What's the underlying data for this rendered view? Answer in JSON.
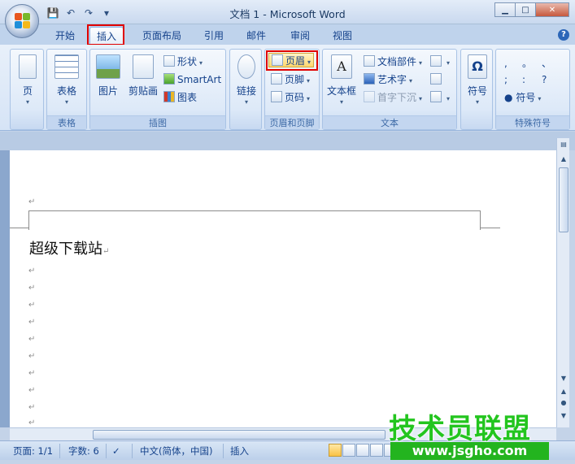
{
  "window": {
    "title": "文档 1 - Microsoft Word",
    "controls": {
      "minimize": "▁",
      "maximize": "□",
      "close": "✕"
    }
  },
  "qat": {
    "save_icon": "save-icon",
    "undo_icon": "undo-icon",
    "redo_icon": "redo-icon",
    "customize_icon": "customize-qat-icon"
  },
  "tabs": [
    {
      "label": "开始"
    },
    {
      "label": "插入"
    },
    {
      "label": "页面布局"
    },
    {
      "label": "引用"
    },
    {
      "label": "邮件"
    },
    {
      "label": "审阅"
    },
    {
      "label": "视图"
    }
  ],
  "active_tab": "插入",
  "ribbon": {
    "pages": {
      "page_label": "页"
    },
    "tables": {
      "table_label": "表格",
      "group_label": "表格"
    },
    "illustrations": {
      "picture_label": "图片",
      "clipart_label": "剪贴画",
      "shapes_label": "形状",
      "smartart_label": "SmartArt",
      "chart_label": "图表",
      "group_label": "插图"
    },
    "links": {
      "link_label": "链接"
    },
    "header_footer": {
      "header_label": "页眉",
      "footer_label": "页脚",
      "page_number_label": "页码",
      "group_label": "页眉和页脚"
    },
    "text": {
      "textbox_label": "文本框",
      "quickparts_label": "文档部件",
      "wordart_label": "艺术字",
      "dropcap_label": "首字下沉",
      "group_label": "文本"
    },
    "symbols": {
      "symbol_label": "符号"
    },
    "special_chars": {
      "chars": [
        ",",
        "。",
        "、",
        ";",
        ":",
        "?"
      ],
      "symbol_label": "符号",
      "group_label": "特殊符号"
    }
  },
  "document": {
    "body_text": "超级下载站",
    "paragraph_mark": "↵"
  },
  "statusbar": {
    "page": "页面: 1/1",
    "words": "字数: 6",
    "language": "中文(简体，中国)",
    "mode": "插入"
  },
  "watermark": {
    "title": "技术员联盟",
    "url": "www.jsgho.com"
  }
}
